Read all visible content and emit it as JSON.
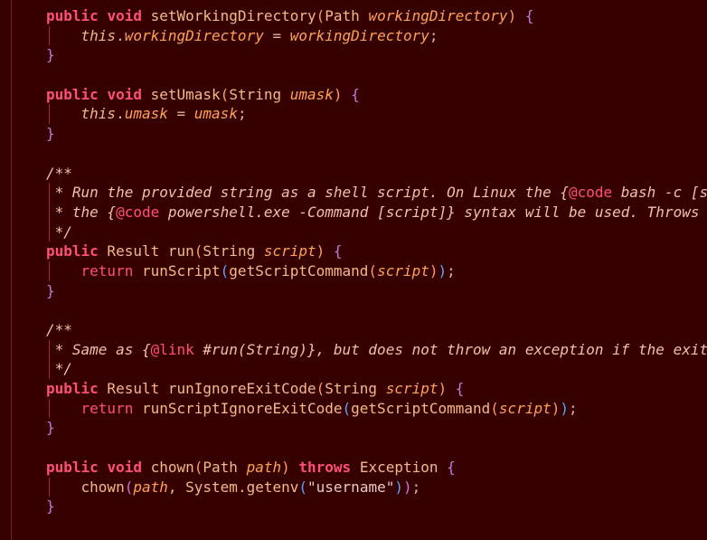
{
  "editor": {
    "colors": {
      "background": "#370000",
      "keyword": "#ff4f7b",
      "text": "#f3b989",
      "param": "#ffa256",
      "comment": "#f2c0a8",
      "guide": "#a02535"
    },
    "lines": [
      [
        {
          "t": "public",
          "c": "kw"
        },
        {
          "t": " ",
          "c": "punc"
        },
        {
          "t": "void",
          "c": "kw"
        },
        {
          "t": " setWorkingDirectory",
          "c": "fn"
        },
        {
          "t": "(",
          "c": "p1"
        },
        {
          "t": "Path ",
          "c": "type"
        },
        {
          "t": "workingDirectory",
          "c": "param"
        },
        {
          "t": ")",
          "c": "p1"
        },
        {
          "t": " {",
          "c": "p2"
        }
      ],
      [
        {
          "t": "    ",
          "c": "punc",
          "guide": true
        },
        {
          "t": "this",
          "c": "this"
        },
        {
          "t": ".",
          "c": "punc"
        },
        {
          "t": "workingDirectory",
          "c": "field"
        },
        {
          "t": " = ",
          "c": "punc"
        },
        {
          "t": "workingDirectory",
          "c": "param"
        },
        {
          "t": ";",
          "c": "punc"
        }
      ],
      [
        {
          "t": "}",
          "c": "p2"
        }
      ],
      [],
      [
        {
          "t": "public",
          "c": "kw"
        },
        {
          "t": " ",
          "c": "punc"
        },
        {
          "t": "void",
          "c": "kw"
        },
        {
          "t": " setUmask",
          "c": "fn"
        },
        {
          "t": "(",
          "c": "p1"
        },
        {
          "t": "String ",
          "c": "type"
        },
        {
          "t": "umask",
          "c": "param"
        },
        {
          "t": ")",
          "c": "p1"
        },
        {
          "t": " {",
          "c": "p2"
        }
      ],
      [
        {
          "t": "    ",
          "c": "punc",
          "guide": true
        },
        {
          "t": "this",
          "c": "this"
        },
        {
          "t": ".",
          "c": "punc"
        },
        {
          "t": "umask",
          "c": "field"
        },
        {
          "t": " = ",
          "c": "punc"
        },
        {
          "t": "umask",
          "c": "param"
        },
        {
          "t": ";",
          "c": "punc"
        }
      ],
      [
        {
          "t": "}",
          "c": "p2"
        }
      ],
      [],
      [
        {
          "t": "/**",
          "c": "doc"
        }
      ],
      [
        {
          "t": " * Run the provided string as a shell script. On Linux the {",
          "c": "doc",
          "guide": true
        },
        {
          "t": "@code",
          "c": "tag"
        },
        {
          "t": " bash -c [s",
          "c": "doc"
        }
      ],
      [
        {
          "t": " * the {",
          "c": "doc",
          "guide": true
        },
        {
          "t": "@code",
          "c": "tag"
        },
        {
          "t": " powershell.exe -Command [script]} syntax will be used. Throws",
          "c": "doc"
        }
      ],
      [
        {
          "t": " */",
          "c": "doc",
          "guide": true
        }
      ],
      [
        {
          "t": "public",
          "c": "kw"
        },
        {
          "t": " Result run",
          "c": "fn"
        },
        {
          "t": "(",
          "c": "p1"
        },
        {
          "t": "String ",
          "c": "type"
        },
        {
          "t": "script",
          "c": "param"
        },
        {
          "t": ")",
          "c": "p1"
        },
        {
          "t": " {",
          "c": "p2"
        }
      ],
      [
        {
          "t": "    ",
          "c": "punc",
          "guide": true
        },
        {
          "t": "return",
          "c": "ret"
        },
        {
          "t": " runScript",
          "c": "fn"
        },
        {
          "t": "(",
          "c": "p3"
        },
        {
          "t": "getScriptCommand",
          "c": "fn"
        },
        {
          "t": "(",
          "c": "p1"
        },
        {
          "t": "script",
          "c": "param"
        },
        {
          "t": ")",
          "c": "p1"
        },
        {
          "t": ")",
          "c": "p3"
        },
        {
          "t": ";",
          "c": "punc"
        }
      ],
      [
        {
          "t": "}",
          "c": "p2"
        }
      ],
      [],
      [
        {
          "t": "/**",
          "c": "doc"
        }
      ],
      [
        {
          "t": " * Same as {",
          "c": "doc",
          "guide": true
        },
        {
          "t": "@link",
          "c": "tag"
        },
        {
          "t": " #run(String)}, but does not throw an exception if the exit",
          "c": "doc"
        }
      ],
      [
        {
          "t": " */",
          "c": "doc",
          "guide": true
        }
      ],
      [
        {
          "t": "public",
          "c": "kw"
        },
        {
          "t": " Result runIgnoreExitCode",
          "c": "fn"
        },
        {
          "t": "(",
          "c": "p1"
        },
        {
          "t": "String ",
          "c": "type"
        },
        {
          "t": "script",
          "c": "param"
        },
        {
          "t": ")",
          "c": "p1"
        },
        {
          "t": " {",
          "c": "p2"
        }
      ],
      [
        {
          "t": "    ",
          "c": "punc",
          "guide": true
        },
        {
          "t": "return",
          "c": "ret"
        },
        {
          "t": " runScriptIgnoreExitCode",
          "c": "fn"
        },
        {
          "t": "(",
          "c": "p3"
        },
        {
          "t": "getScriptCommand",
          "c": "fn"
        },
        {
          "t": "(",
          "c": "p1"
        },
        {
          "t": "script",
          "c": "param"
        },
        {
          "t": ")",
          "c": "p1"
        },
        {
          "t": ")",
          "c": "p3"
        },
        {
          "t": ";",
          "c": "punc"
        }
      ],
      [
        {
          "t": "}",
          "c": "p2"
        }
      ],
      [],
      [
        {
          "t": "public",
          "c": "kw"
        },
        {
          "t": " ",
          "c": "punc"
        },
        {
          "t": "void",
          "c": "kw"
        },
        {
          "t": " chown",
          "c": "fn"
        },
        {
          "t": "(",
          "c": "p1"
        },
        {
          "t": "Path ",
          "c": "type"
        },
        {
          "t": "path",
          "c": "param"
        },
        {
          "t": ")",
          "c": "p1"
        },
        {
          "t": " ",
          "c": "punc"
        },
        {
          "t": "throws",
          "c": "kw"
        },
        {
          "t": " Exception",
          "c": "type"
        },
        {
          "t": " {",
          "c": "p2"
        }
      ],
      [
        {
          "t": "    ",
          "c": "punc",
          "guide": true
        },
        {
          "t": "chown",
          "c": "fn"
        },
        {
          "t": "(",
          "c": "p2"
        },
        {
          "t": "path",
          "c": "param"
        },
        {
          "t": ", System.getenv",
          "c": "fn"
        },
        {
          "t": "(",
          "c": "p3"
        },
        {
          "t": "\"username\"",
          "c": "str"
        },
        {
          "t": ")",
          "c": "p3"
        },
        {
          "t": ")",
          "c": "p2"
        },
        {
          "t": ";",
          "c": "punc"
        }
      ],
      [
        {
          "t": "}",
          "c": "p2"
        }
      ]
    ]
  }
}
